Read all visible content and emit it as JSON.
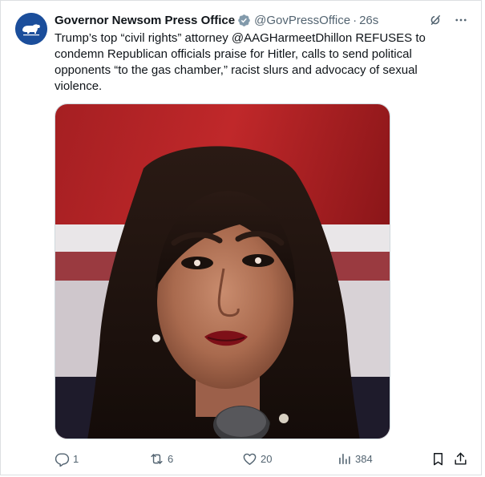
{
  "post": {
    "author_name": "Governor Newsom Press Office",
    "handle": "@GovPressOffice",
    "separator": "·",
    "timestamp": "26s",
    "text": "Trump’s top “civil rights” attorney @AAGHarmeetDhillon REFUSES to condemn Republican officials praise for Hitler, calls to send political opponents “to the gas chamber,” racist slurs and advocacy of sexual violence.",
    "verified": true
  },
  "icons": {
    "avatar": "california-bear-seal",
    "verified": "verified-badge-icon",
    "grok": "grok-icon",
    "more": "more-icon",
    "reply": "reply-icon",
    "repost": "repost-icon",
    "like": "heart-icon",
    "views": "views-icon",
    "bookmark": "bookmark-icon",
    "share": "share-icon"
  },
  "stats": {
    "replies": "1",
    "reposts": "6",
    "likes": "20",
    "views": "384"
  },
  "colors": {
    "text": "#0f1419",
    "secondary": "#536471",
    "verified_badge": "#829aab",
    "avatar_bg": "#1b4e9b",
    "border": "#cfd9de"
  }
}
